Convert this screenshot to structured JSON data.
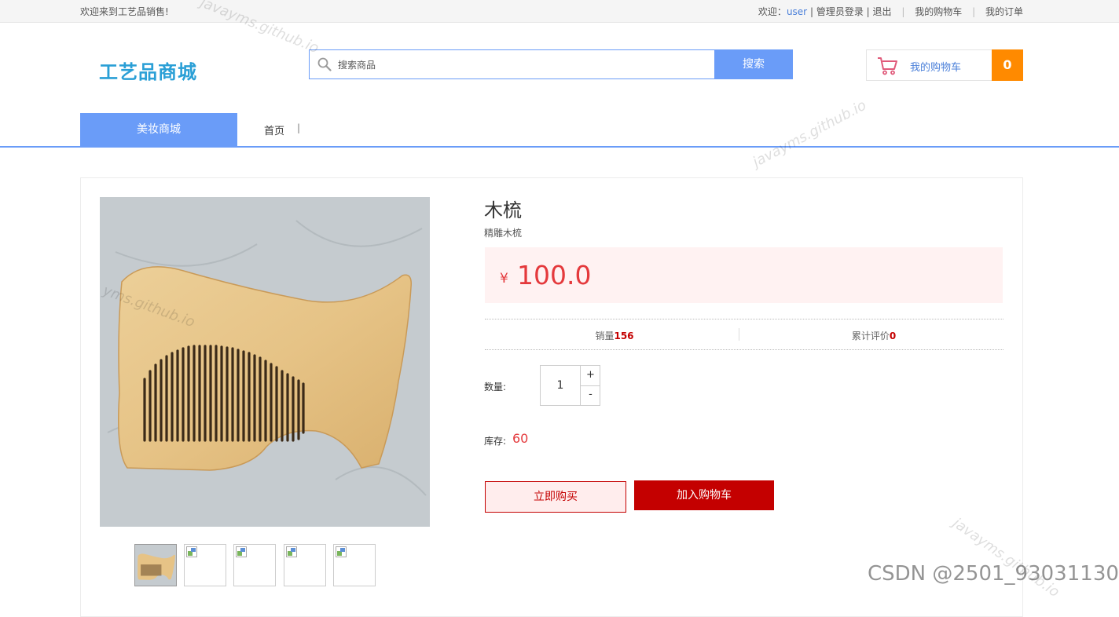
{
  "topbar": {
    "welcome": "欢迎来到工艺品销售!",
    "greeting_prefix": "欢迎：",
    "username": "user",
    "divider": "|",
    "admin_login": "管理员登录",
    "logout": "退出",
    "my_cart": "我的购物车",
    "my_orders": "我的订单"
  },
  "header": {
    "logo": "工艺品商城",
    "search_placeholder": "搜索商品",
    "search_button": "搜索",
    "cart_label": "我的购物车",
    "cart_count": "0"
  },
  "nav": {
    "category": "美妆商城",
    "home": "首页",
    "separator": "|"
  },
  "product": {
    "name": "木梳",
    "subtitle": "精雕木梳",
    "currency": "¥",
    "price": "100.0",
    "sales_label": "销量",
    "sales_value": "156",
    "reviews_label": "累计评价",
    "reviews_value": "0",
    "quantity_label": "数量:",
    "quantity_value": "1",
    "increment": "+",
    "decrement": "-",
    "stock_label": "库存:",
    "stock_value": "60",
    "buy_now": "立即购买",
    "add_to_cart": "加入购物车",
    "thumbnail_count": 5
  },
  "watermarks": {
    "site": "javayms.github.io",
    "site_partial": "yms.github.io",
    "csdn": "CSDN @2501_93031130"
  },
  "colors": {
    "accent": "#6a9cf8",
    "price_red": "#e4393c",
    "buy_red": "#c40000",
    "cart_orange": "#ff8a00",
    "logo_blue": "#2a9fd6"
  }
}
